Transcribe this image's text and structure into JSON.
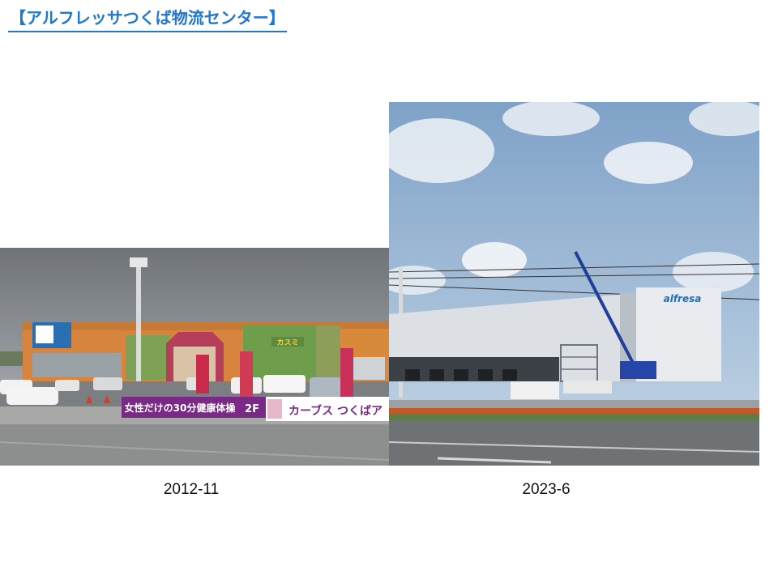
{
  "title": "【アルフレッサつくば物流センター】",
  "photos": [
    {
      "caption": "2012-11",
      "signs": {
        "banner": "女性だけの30分健康体操",
        "banner_floor": "2F",
        "banner_right": "カーブス つくばア",
        "store_sign": "カスミ"
      }
    },
    {
      "caption": "2023-6",
      "signs": {
        "logo": "alfresa"
      }
    }
  ],
  "colors": {
    "title": "#1f77d0",
    "caption": "#111111"
  }
}
